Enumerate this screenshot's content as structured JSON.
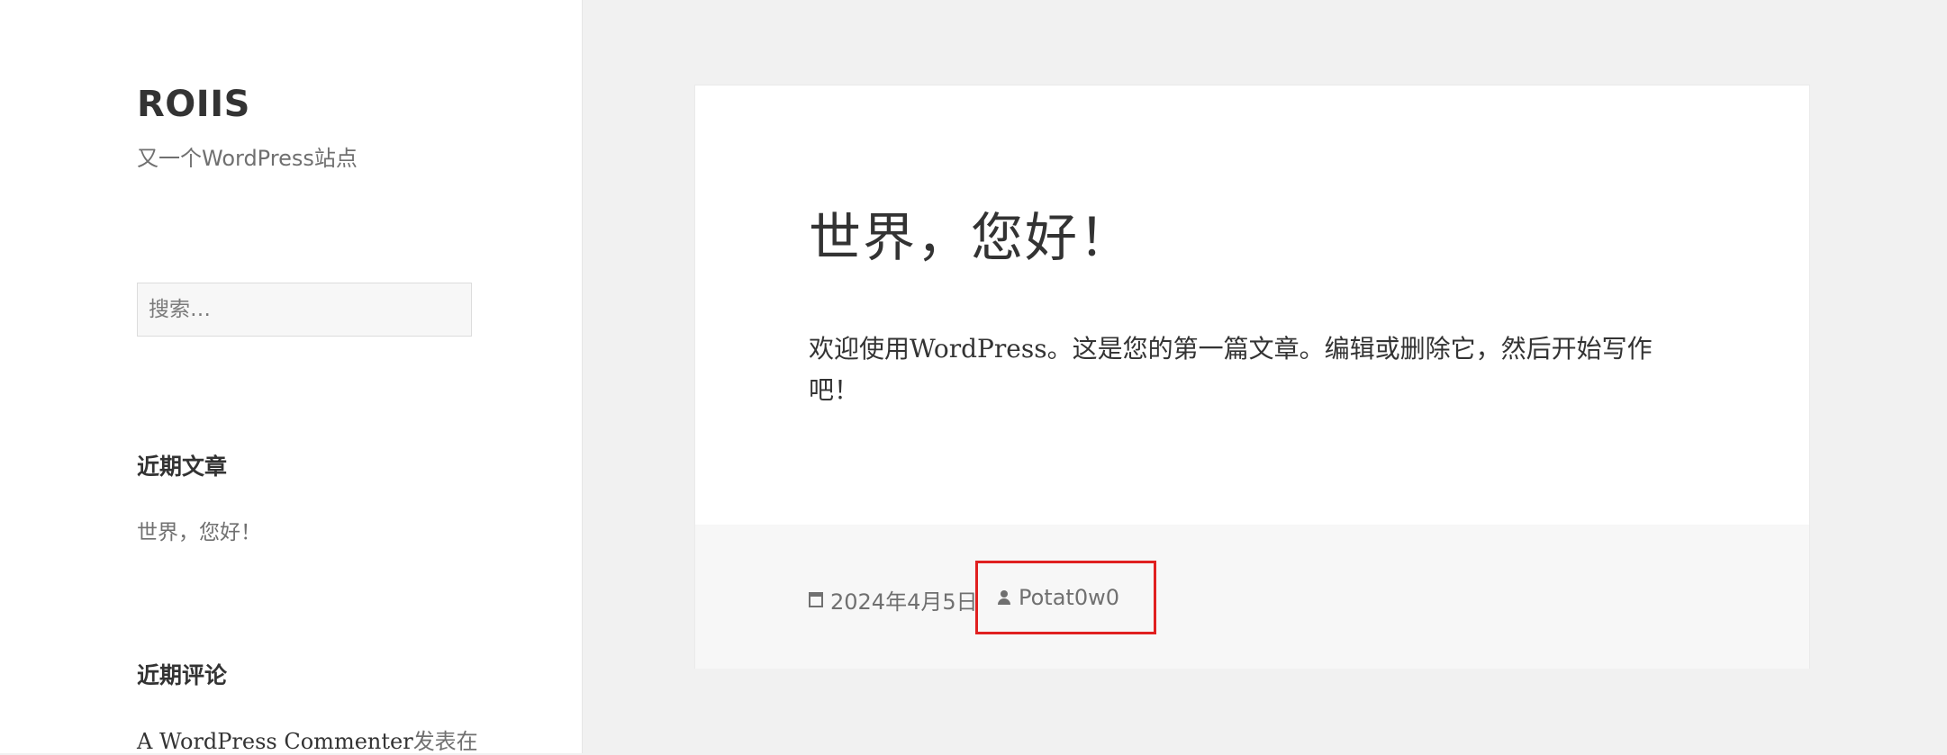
{
  "site": {
    "title": "ROIIS",
    "description": "又一个WordPress站点"
  },
  "search": {
    "placeholder": "搜索…"
  },
  "widgets": {
    "recent_posts": {
      "title": "近期文章",
      "items": [
        "世界，您好！"
      ]
    },
    "recent_comments": {
      "title": "近期评论",
      "items": [
        {
          "author": "A WordPress Commenter",
          "text": "发表在"
        }
      ]
    }
  },
  "post": {
    "title": "世界，您好！",
    "content": "欢迎使用WordPress。这是您的第一篇文章。编辑或删除它，然后开始写作吧！",
    "date": "2024年4月5日",
    "author": "Potat0w0"
  },
  "colors": {
    "highlight_border": "#e02020",
    "sidebar_bg": "#ffffff",
    "page_bg": "#f1f1f1"
  },
  "icons": {
    "date": "calendar-icon",
    "author": "person-icon"
  }
}
